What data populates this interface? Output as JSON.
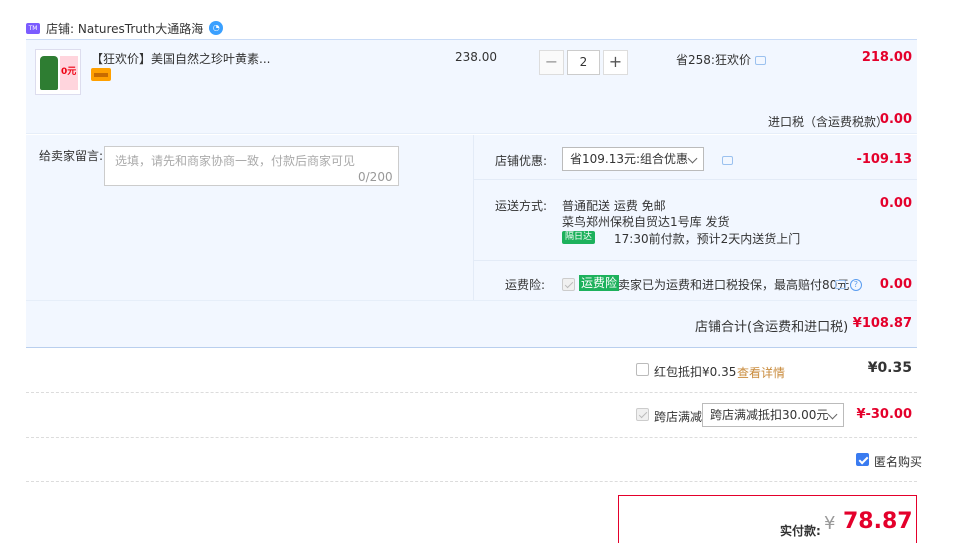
{
  "shop": {
    "label": "店铺: NaturesTruth大通路海",
    "logo_icon": "tmall-shop-icon",
    "chat_icon": "wangwang-icon"
  },
  "item": {
    "thumb_badge": "0元",
    "title": "【狂欢价】美国自然之珍叶黄素...",
    "unit_price": "238.00",
    "quantity": "2",
    "minus": "−",
    "plus": "+",
    "promo": "省258:狂欢价",
    "total": "218.00"
  },
  "tax": {
    "label": "进口税（含运费税款）",
    "value": "0.00"
  },
  "memo": {
    "label": "给卖家留言:",
    "placeholder": "选填，请先和商家协商一致，付款后商家可见",
    "count": "0/200"
  },
  "discount": {
    "label": "店铺优惠:",
    "selected": "省109.13元:组合优惠",
    "value": "-109.13"
  },
  "shipping": {
    "label": "运送方式:",
    "method": "普通配送 运费 免邮",
    "warehouse": "菜鸟郑州保税自贸达1号库   发货",
    "badge": "隔日达",
    "eta": "17:30前付款，预计2天内送货上门",
    "value": "0.00"
  },
  "insurance": {
    "label": "运费险:",
    "tag": "运费险",
    "text": "卖家已为运费和进口税投保，最高赔付80元",
    "value": "0.00"
  },
  "subtotal": {
    "label": "店铺合计(含运费和进口税)",
    "value": "¥108.87"
  },
  "redpack": {
    "label": "红包抵扣¥0.35",
    "link": "查看详情",
    "value": "¥0.35"
  },
  "cross_store": {
    "label": "跨店满减",
    "selected": "跨店满减抵扣30.00元",
    "value": "¥-30.00"
  },
  "anonymous": {
    "label": "匿名购买",
    "checked": true
  },
  "payment": {
    "label": "实付款:",
    "yen": "¥",
    "value": "78.87"
  },
  "colors": {
    "accent_red": "#e4002b",
    "panel_blue": "#f2f7ff",
    "green_badge": "#1db15c",
    "check_blue": "#3a7bf0"
  }
}
